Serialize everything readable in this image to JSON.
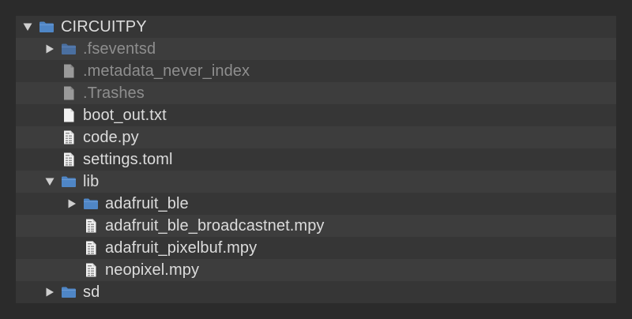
{
  "colors": {
    "background": "#2b2b2b",
    "panel": "#363636",
    "row_alt": "#3d3d3d",
    "text": "#dcdcdc",
    "text_dim": "#8e8e8e",
    "folder": "#4f86c6"
  },
  "tree": [
    {
      "label": "CIRCUITPY",
      "type": "folder",
      "expanded": true,
      "depth": 0,
      "dim": false,
      "icon": "folder-icon"
    },
    {
      "label": ".fseventsd",
      "type": "folder",
      "expanded": false,
      "depth": 1,
      "dim": true,
      "icon": "folder-icon"
    },
    {
      "label": ".metadata_never_index",
      "type": "file",
      "depth": 1,
      "dim": true,
      "icon": "file-icon"
    },
    {
      "label": ".Trashes",
      "type": "file",
      "depth": 1,
      "dim": true,
      "icon": "file-icon"
    },
    {
      "label": "boot_out.txt",
      "type": "file",
      "depth": 1,
      "dim": false,
      "icon": "text-file-icon"
    },
    {
      "label": "code.py",
      "type": "file",
      "depth": 1,
      "dim": false,
      "icon": "code-file-icon"
    },
    {
      "label": "settings.toml",
      "type": "file",
      "depth": 1,
      "dim": false,
      "icon": "code-file-icon"
    },
    {
      "label": "lib",
      "type": "folder",
      "expanded": true,
      "depth": 1,
      "dim": false,
      "icon": "folder-icon"
    },
    {
      "label": "adafruit_ble",
      "type": "folder",
      "expanded": false,
      "depth": 2,
      "dim": false,
      "icon": "folder-icon"
    },
    {
      "label": "adafruit_ble_broadcastnet.mpy",
      "type": "file",
      "depth": 2,
      "dim": false,
      "icon": "code-file-icon"
    },
    {
      "label": "adafruit_pixelbuf.mpy",
      "type": "file",
      "depth": 2,
      "dim": false,
      "icon": "code-file-icon"
    },
    {
      "label": "neopixel.mpy",
      "type": "file",
      "depth": 2,
      "dim": false,
      "icon": "code-file-icon"
    },
    {
      "label": "sd",
      "type": "folder",
      "expanded": false,
      "depth": 1,
      "dim": false,
      "icon": "folder-icon"
    }
  ]
}
